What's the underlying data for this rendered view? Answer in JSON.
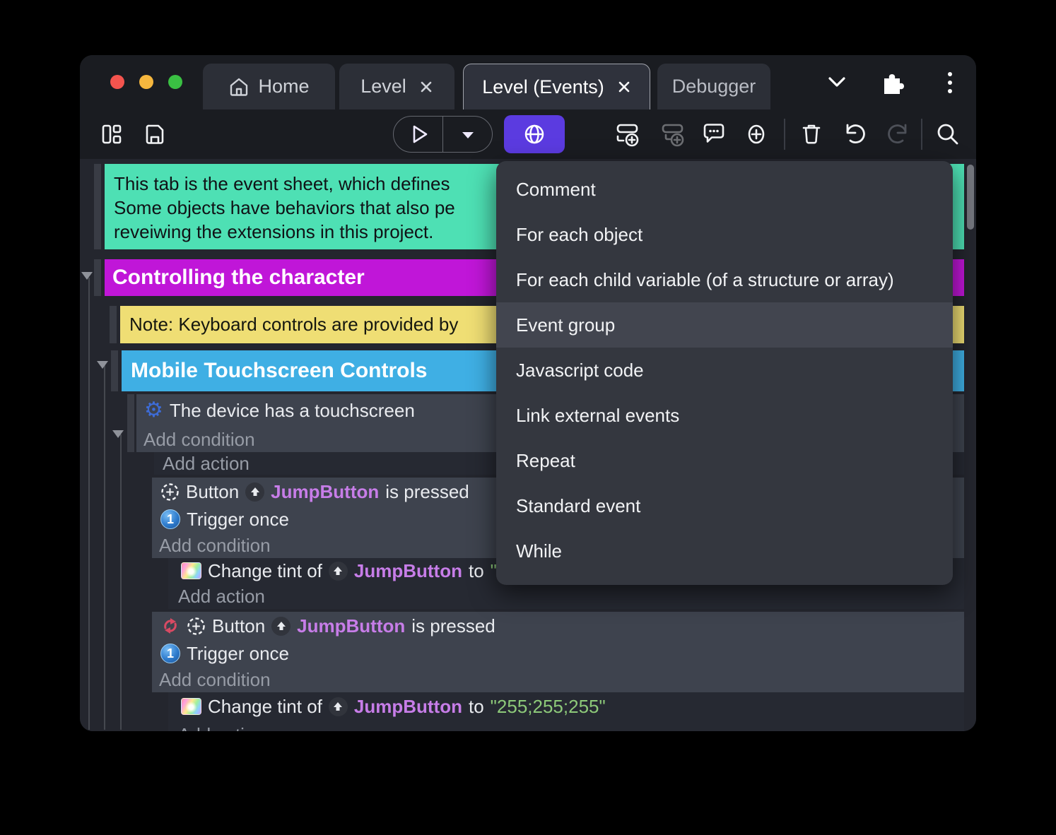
{
  "colors": {
    "teal": "#4ee0b4",
    "magenta": "#c016d8",
    "yellow": "#efde74",
    "blue": "#3fafe4",
    "accent_purple": "#5b3be0",
    "object_purple": "#c77de8",
    "string_green": "#8dc979"
  },
  "titlebar": {
    "tabs": {
      "home": "Home",
      "level": "Level",
      "level_events": "Level (Events)",
      "debugger": "Debugger"
    }
  },
  "event_sheet": {
    "comment_lines": [
      "This tab is the event sheet, which defines",
      "Some objects have behaviors that also pe",
      "reveiwing the extensions in this project."
    ],
    "group_controlling": "Controlling the character",
    "note": "Note: Keyboard controls are provided by",
    "group_mobile": "Mobile Touchscreen Controls",
    "touch_condition": "The device has a touchscreen",
    "add_condition": "Add condition",
    "add_action": "Add action",
    "button_obj_type": "Button",
    "object_name": "JumpButton",
    "pressed_suffix": "is pressed",
    "trigger_once": "Trigger once",
    "trigger_badge": "1",
    "tint_action_prefix": "Change tint of",
    "tint_action_to": "to",
    "tint_value": "\"255;255;255\""
  },
  "menu": {
    "items": [
      "Comment",
      "For each object",
      "For each child variable (of a structure or array)",
      "Event group",
      "Javascript code",
      "Link external events",
      "Repeat",
      "Standard event",
      "While"
    ]
  }
}
